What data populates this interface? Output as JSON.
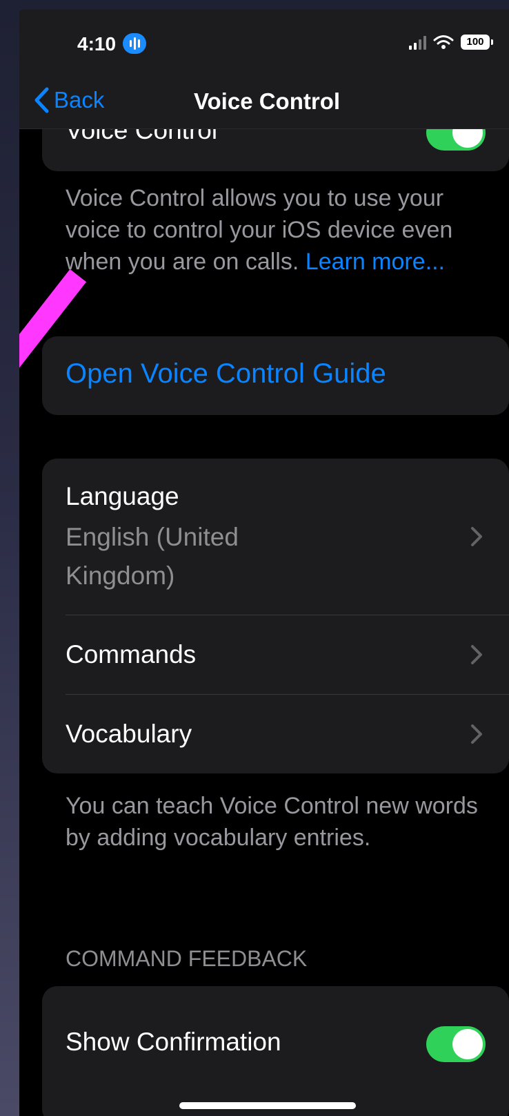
{
  "status_bar": {
    "time": "4:10",
    "battery": "100",
    "icons": [
      "voice-control-indicator-icon",
      "cellular-signal-icon",
      "wifi-icon",
      "battery-icon"
    ]
  },
  "nav": {
    "back_label": "Back",
    "title": "Voice Control"
  },
  "top_group": {
    "label": "Voice Control",
    "toggle_on": true
  },
  "description": {
    "text": "Voice Control allows you to use your voice to control your iOS device even when you are on calls.",
    "link": "Learn more..."
  },
  "guide_button": "Open Voice Control Guide",
  "settings_group": {
    "language_label": "Language",
    "language_value": "English (United Kingdom)",
    "commands_label": "Commands",
    "vocabulary_label": "Vocabulary"
  },
  "vocabulary_footer": "You can teach Voice Control new words by adding vocabulary entries.",
  "command_feedback": {
    "header": "COMMAND FEEDBACK",
    "show_confirmation_label": "Show Confirmation",
    "show_confirmation_on": true
  },
  "colors": {
    "accent": "#0a84ff",
    "toggle_on": "#30d158",
    "annotation": "#ff37ff"
  }
}
